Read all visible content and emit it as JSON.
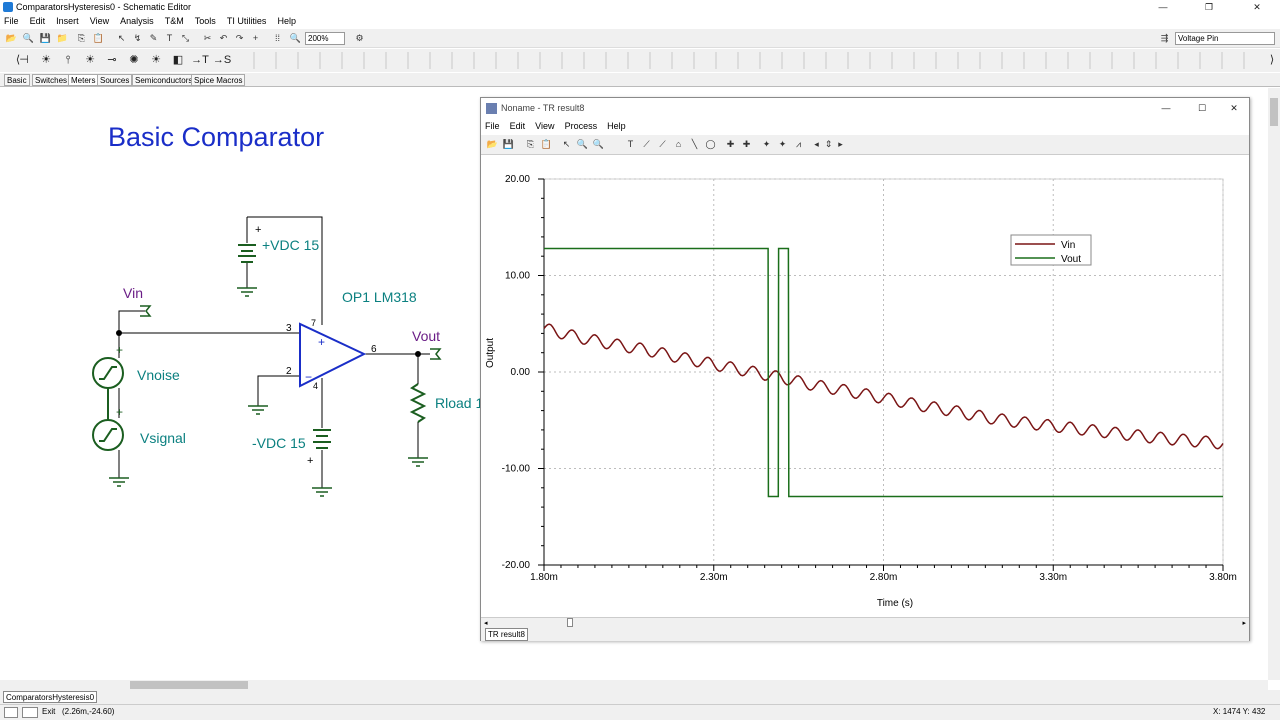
{
  "window": {
    "title": "ComparatorsHysteresis0 - Schematic Editor",
    "controls": [
      "—",
      "❐",
      "✕"
    ]
  },
  "menu": [
    "File",
    "Edit",
    "Insert",
    "View",
    "Analysis",
    "T&M",
    "Tools",
    "TI Utilities",
    "Help"
  ],
  "toolbar": {
    "zoom": "200%",
    "pin_select": "Voltage Pin"
  },
  "component_tabs": [
    "Basic",
    "Switches",
    "Meters",
    "Sources",
    "Semiconductors",
    "Spice Macros"
  ],
  "schematic": {
    "heading": "Basic Comparator",
    "labels": {
      "vdc_pos": "+VDC 15",
      "vdc_neg": "-VDC 15",
      "opamp": "OP1 LM318",
      "vin": "Vin",
      "vout": "Vout",
      "vnoise": "Vnoise",
      "vsignal": "Vsignal",
      "rload": "Rload 1",
      "pin3": "3",
      "pin2": "2",
      "pin6": "6",
      "pin7": "7",
      "pin4": "4",
      "plus": "+",
      "minus": "−"
    },
    "colors": {
      "wire": "#000000",
      "component": "#1b5e20",
      "opamp": "#1a2ec8",
      "heading": "#1a2ec8",
      "label": "#0b8080",
      "pin_label": "#6a1d86"
    }
  },
  "tr_window": {
    "title": "Noname - TR result8",
    "menu": [
      "File",
      "Edit",
      "View",
      "Process",
      "Help"
    ],
    "tab": "TR result8",
    "controls": [
      "—",
      "☐",
      "✕"
    ]
  },
  "chart_data": {
    "type": "line",
    "xlabel": "Time (s)",
    "ylabel": "Output",
    "xlim": [
      1.8,
      3.8
    ],
    "ylim": [
      -20,
      20
    ],
    "xticks": [
      "1.80m",
      "2.30m",
      "2.80m",
      "3.30m",
      "3.80m"
    ],
    "yticks": [
      "20.00",
      "10.00",
      "0.00",
      "-10.00",
      "-20.00"
    ],
    "grid": true,
    "legend": "top-right",
    "series": [
      {
        "name": "Vin",
        "color": "#7a1515",
        "x": [
          1.8,
          1.9,
          2.0,
          2.1,
          2.2,
          2.3,
          2.4,
          2.5,
          2.6,
          2.7,
          2.8,
          2.9,
          3.0,
          3.1,
          3.2,
          3.3,
          3.4,
          3.5,
          3.6,
          3.7,
          3.8
        ],
        "values": [
          4.5,
          3.6,
          2.9,
          2.3,
          1.5,
          0.8,
          0.1,
          -0.6,
          -1.4,
          -2.0,
          -2.7,
          -3.4,
          -4.0,
          -4.7,
          -5.2,
          -5.6,
          -6.0,
          -6.4,
          -6.8,
          -7.1,
          -7.4
        ]
      },
      {
        "name": "Vout",
        "color": "#1a6e1a",
        "x": [
          1.8,
          2.46,
          2.461,
          2.49,
          2.491,
          2.52,
          2.521,
          3.8
        ],
        "values": [
          12.8,
          12.8,
          -12.9,
          -12.9,
          12.8,
          12.8,
          -12.9,
          -12.9
        ]
      }
    ]
  },
  "status": {
    "coords": "(2.26m,-24.60)",
    "exit": "Exit",
    "cursor": "X: 1474  Y: 432"
  },
  "bottom_tab": "ComparatorsHysteresis0"
}
